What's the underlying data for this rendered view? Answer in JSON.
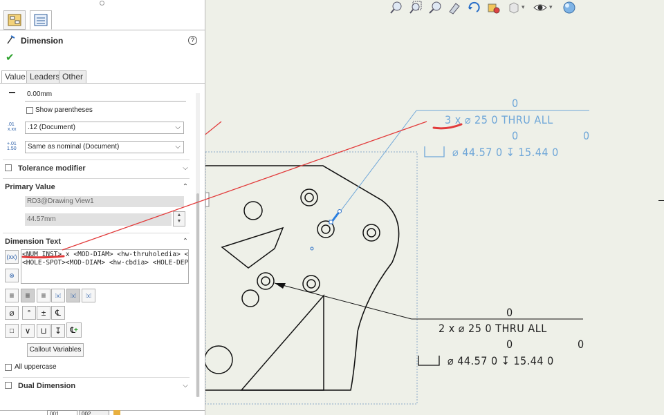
{
  "panel": {
    "title": "Dimension",
    "help_icon": "help-icon",
    "ok_icon": "checkmark-icon",
    "tabs": [
      "Value",
      "Leaders",
      "Other"
    ],
    "value_field": "0.00mm",
    "show_parentheses": "Show parentheses",
    "tolerance_precision": ".12 (Document)",
    "unit_precision": "Same as nominal (Document)",
    "tolerance_modifier": "Tolerance modifier",
    "primary_value": {
      "title": "Primary Value",
      "name": "RD3@Drawing View1",
      "value": "44.57mm"
    },
    "dimension_text": {
      "title": "Dimension Text",
      "line1_highlight": "<NUM_INST>",
      "line1_rest": " x <MOD-DIAM> <hw-thruholedia> <hw-",
      "line2": "<HOLE-SPOT><MOD-DIAM> <hw-cbdia> <HOLE-DEPT"
    },
    "symbol_buttons": [
      "⌀",
      "°",
      "±",
      "℄",
      "□",
      "∨",
      "⊔",
      "↧"
    ],
    "callout_variables": "Callout Variables",
    "all_uppercase": "All uppercase",
    "dual_dimension": "Dual Dimension",
    "bottom_tabs": [
      "001",
      "002"
    ]
  },
  "toolbar": {
    "icons": [
      "zoom-to-fit-icon",
      "zoom-area-icon",
      "zoom-in-out-icon",
      "section-view-icon",
      "rotate-icon",
      "view-orientation-icon",
      "display-style-icon",
      "hide-show-icon",
      "appearance-icon"
    ]
  },
  "callout_blue": {
    "top_zero": "0",
    "line1": "3 x  ⌀  25   0  THRU ALL",
    "mid_zero": "0",
    "right_zero": "0",
    "line2": "⌀  44.57   0   ↧  15.44   0"
  },
  "callout_black": {
    "top_zero": "0",
    "line1": "2 x  ⌀  25   0  THRU ALL",
    "mid_zero": "0",
    "right_zero": "0",
    "line2": "⌀  44.57   0   ↧  15.44   0"
  },
  "colors": {
    "annotation_red": "#e23a3a",
    "dimension_blue": "#6ea6d8",
    "background": "#eef0e8"
  }
}
